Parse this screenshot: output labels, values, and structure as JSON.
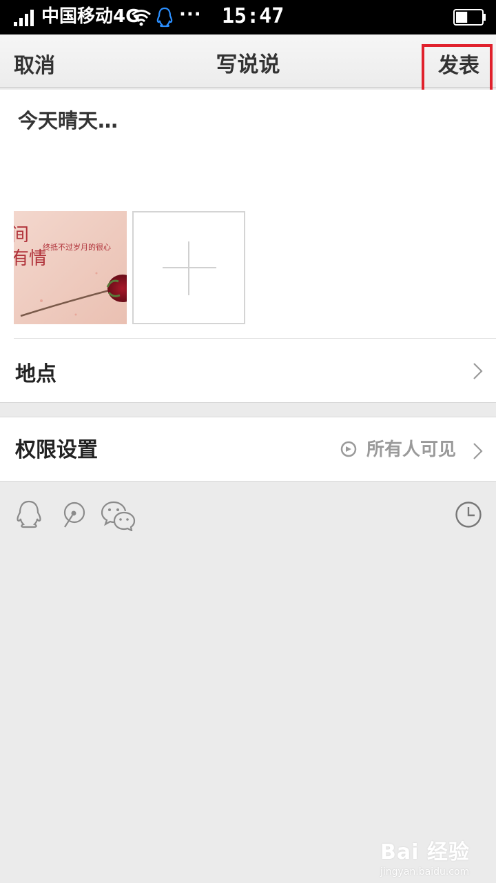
{
  "status_bar": {
    "carrier": "中国移动4G",
    "dots": "···",
    "time": "15:47",
    "battery_level": 0.45,
    "icons": [
      "signal-icon",
      "wifi-icon",
      "qq-notification-icon",
      "battery-icon"
    ]
  },
  "navbar": {
    "cancel_label": "取消",
    "title": "写说说",
    "publish_label": "发表",
    "highlight_color": "#e0212c"
  },
  "compose": {
    "text": "今天晴天…",
    "photo": {
      "text_line1": "间",
      "text_line2": "有情",
      "caption": "终抵不过岁月的很心"
    },
    "add_photo_icon": "plus-icon"
  },
  "location": {
    "label": "地点"
  },
  "permission": {
    "label": "权限设置",
    "value": "所有人可见",
    "icon": "globe-icon"
  },
  "share_icons": [
    "qq-icon",
    "weibo-icon",
    "wechat-icon",
    "clock-icon"
  ],
  "watermark": {
    "main": "Bai 经验",
    "sub": "jingyan.baidu.com"
  }
}
